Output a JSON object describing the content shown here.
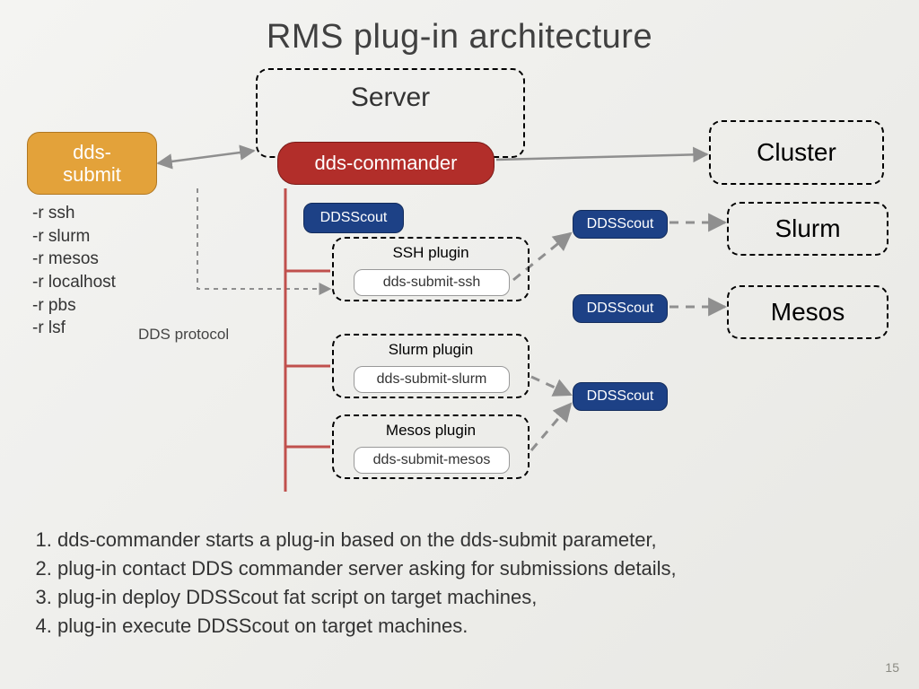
{
  "title": "RMS plug-in architecture",
  "server": {
    "label": "Server"
  },
  "dds_submit": {
    "label": "dds-\nsubmit"
  },
  "dds_commander": {
    "label": "dds-commander"
  },
  "cluster": {
    "label": "Cluster"
  },
  "slurm": {
    "label": "Slurm"
  },
  "mesos": {
    "label": "Mesos"
  },
  "rms_options": [
    "-r ssh",
    "-r slurm",
    "-r mesos",
    "-r localhost",
    "-r pbs",
    "-r lsf"
  ],
  "dds_protocol": "DDS protocol",
  "ddsscout": "DDSScout",
  "plugins": {
    "ssh": {
      "title": "SSH plugin",
      "submit": "dds-submit-ssh"
    },
    "slurm": {
      "title": "Slurm plugin",
      "submit": "dds-submit-slurm"
    },
    "mesos": {
      "title": "Mesos plugin",
      "submit": "dds-submit-mesos"
    }
  },
  "steps": [
    "dds-commander starts a plug-in based on the dds-submit parameter,",
    "plug-in contact DDS commander server asking for submissions details,",
    "plug-in deploy DDSScout fat script on target machines,",
    "plug-in execute DDSScout on target machines."
  ],
  "page_number": "15",
  "colors": {
    "orange": "#e3a23a",
    "red": "#b22e2a",
    "blue": "#1d4186",
    "grey_arrow": "#8f8f8f",
    "red_line": "#c0504d"
  }
}
